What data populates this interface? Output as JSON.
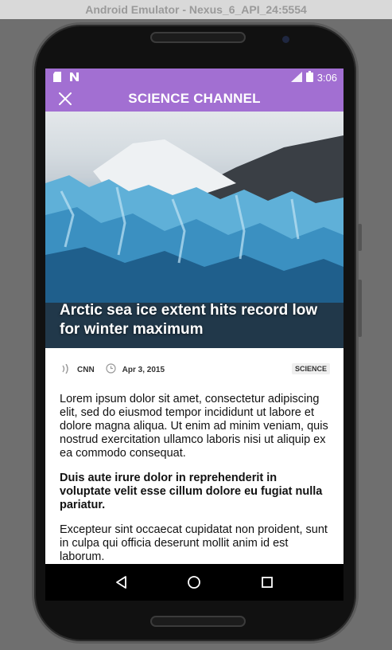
{
  "emulator": {
    "title": "Android Emulator - Nexus_6_API_24:5554"
  },
  "statusbar": {
    "time": "3:06",
    "left_icons": [
      "sd-card-icon",
      "n-notification-icon"
    ],
    "right_icons": [
      "lte-signal-icon",
      "battery-icon"
    ]
  },
  "appbar": {
    "title": "SCIENCE CHANNEL",
    "close_icon": "close-icon"
  },
  "hero": {
    "headline": "Arctic sea ice extent hits record low for winter maximum"
  },
  "meta": {
    "source": "CNN",
    "date": "Apr 3, 2015",
    "category": "SCIENCE"
  },
  "article": {
    "paragraphs": [
      "Lorem ipsum dolor sit amet, consectetur adipiscing elit, sed do eiusmod tempor incididunt ut labore et dolore magna aliqua. Ut enim ad minim veniam, quis nostrud exercitation ullamco laboris nisi ut aliquip ex ea commodo consequat.",
      "Duis aute irure dolor in reprehenderit in voluptate velit esse cillum dolore eu fugiat nulla pariatur.",
      "Excepteur sint occaecat cupidatat non proident, sunt in culpa qui officia deserunt mollit anim id est laborum."
    ]
  },
  "navbar": {
    "back": "back-icon",
    "home": "home-icon",
    "recents": "recents-icon"
  },
  "colors": {
    "accent": "#a26fd2"
  }
}
